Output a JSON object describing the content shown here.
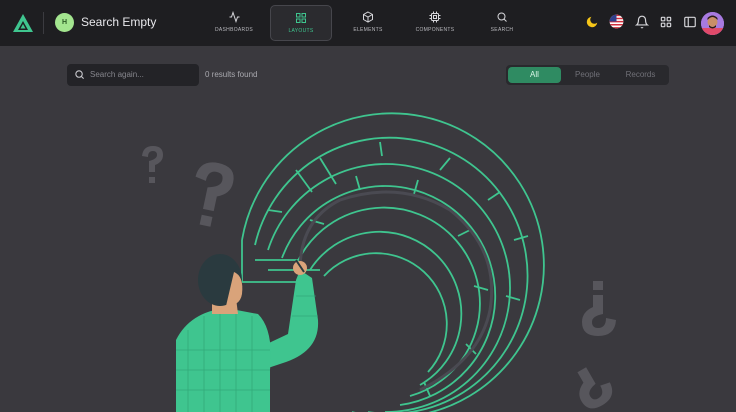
{
  "header": {
    "workspace_initial": "H",
    "title": "Search Empty",
    "nav": [
      {
        "label": "DASHBOARDS",
        "icon": "activity-icon"
      },
      {
        "label": "LAYOUTS",
        "icon": "grid-icon",
        "active": true
      },
      {
        "label": "ELEMENTS",
        "icon": "box-icon"
      },
      {
        "label": "COMPONENTS",
        "icon": "cpu-icon"
      },
      {
        "label": "SEARCH",
        "icon": "search-icon"
      }
    ],
    "tools": [
      "moon-icon",
      "us-flag-icon",
      "bell-icon",
      "apps-grid-icon",
      "sidebar-toggle-icon",
      "avatar"
    ]
  },
  "search": {
    "placeholder": "Search again...",
    "results_text": "0 results found"
  },
  "filters": [
    "All",
    "People",
    "Records"
  ],
  "active_filter": "All",
  "colors": {
    "topbar": "#1e1e21",
    "background": "#3a393e",
    "accent": "#2f8b62",
    "maze_stroke": "#3fc58f",
    "logo": "#3fc58f",
    "workspace_badge": "#a3e58f"
  }
}
